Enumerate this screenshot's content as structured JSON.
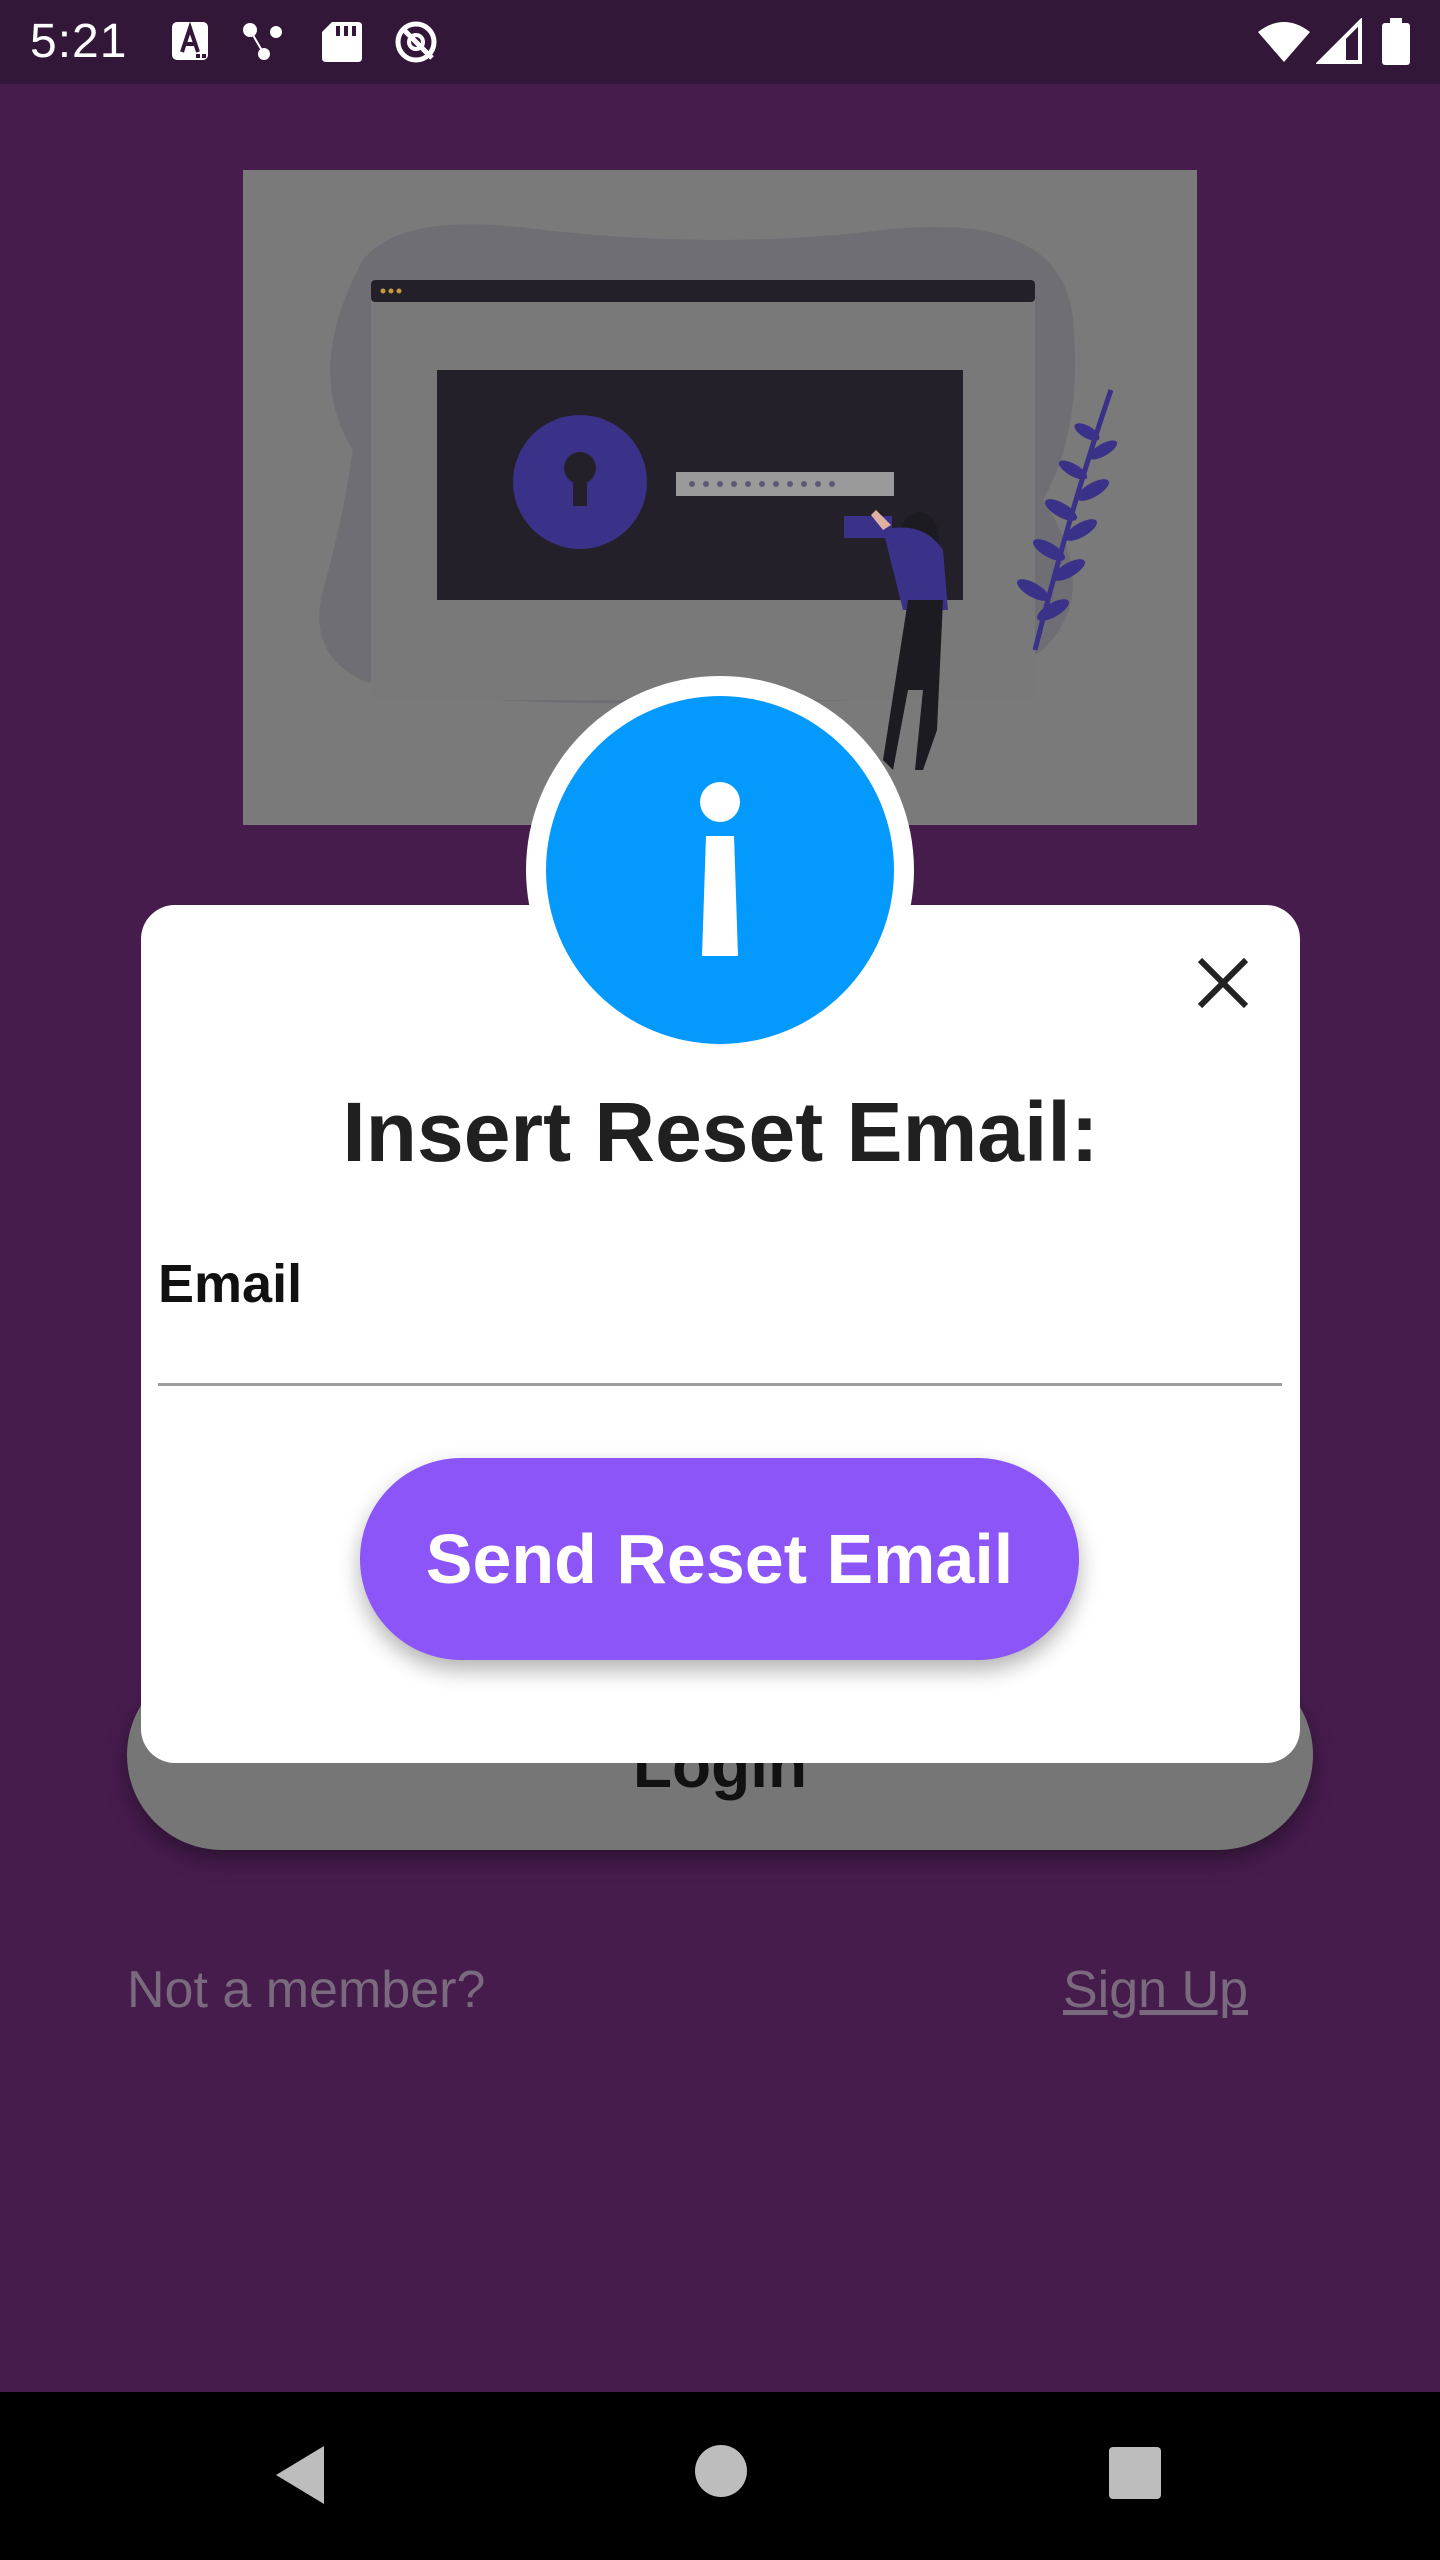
{
  "status_bar": {
    "time": "5:21",
    "left_icons": [
      "app-a-icon",
      "nodes-icon",
      "sd-card-icon",
      "no-location-icon"
    ],
    "right_icons": [
      "wifi-icon",
      "signal-icon",
      "battery-icon"
    ]
  },
  "background": {
    "illustration_name": "lock-screen-illustration",
    "login_label": "Login",
    "not_member_text": "Not a member?",
    "sign_up_link": "Sign Up"
  },
  "dialog": {
    "title": "Insert Reset Email:",
    "email_label": "Email",
    "email_value": "",
    "send_button_label": "Send Reset Email",
    "badge_icon": "info-icon",
    "close_icon": "close-icon"
  },
  "nav_bar": {
    "icons": [
      "back-icon",
      "home-icon",
      "recents-icon"
    ]
  },
  "colors": {
    "background": "#461c4d",
    "status_bar": "#331739",
    "dialog_bg": "#ffffff",
    "info_badge": "#0399fd",
    "accent_button": "#8c55f8",
    "muted_text": "#7a6a7e"
  }
}
